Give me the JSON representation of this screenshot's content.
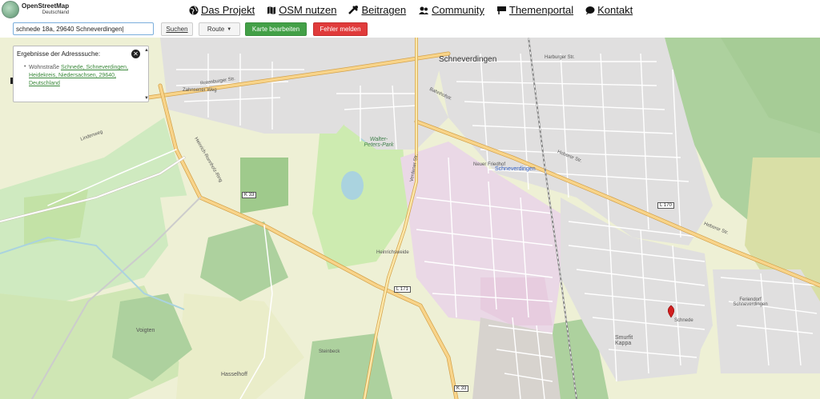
{
  "logo": {
    "title": "OpenStreetMap",
    "subtitle": "Deutschland"
  },
  "nav": [
    {
      "label": "Das Projekt",
      "icon": "globe-icon"
    },
    {
      "label": "OSM nutzen",
      "icon": "map-icon"
    },
    {
      "label": "Beitragen",
      "icon": "tools-icon"
    },
    {
      "label": "Community",
      "icon": "people-icon"
    },
    {
      "label": "Themenportal",
      "icon": "flag-icon"
    },
    {
      "label": "Kontakt",
      "icon": "chat-icon"
    }
  ],
  "toolbar": {
    "search_value": "schnede 18a, 29640 Schneverdingen|",
    "search_button": "Suchen",
    "route_button": "Route",
    "edit_button": "Karte bearbeiten",
    "report_button": "Fehler melden"
  },
  "results": {
    "title": "Ergebnisse der Adresssuche:",
    "item_prefix": "Wohnstraße",
    "item_link": "Schnede, Schneverdingen, Heidekreis, Niedersachsen, 29640, Deutschland"
  },
  "map": {
    "labels": {
      "town": "Schneverdingen",
      "station": "Schneverdingen",
      "park": "Walter-Peters-Park",
      "friedhof": "Neuer Friedhof",
      "smurfit": "Smurfit Kappa",
      "feriendorf": "Feriendorf Schneverdingen",
      "voigten": "Voigten",
      "hasselhoff": "Hasselhoff",
      "schnede": "Schnede",
      "rotenburger": "Rotenburger Str.",
      "bahnhof": "Bahnhofstr.",
      "heberer": "Heberer Str.",
      "heberer2": "Heberer Str.",
      "verdener": "Verdener Str.",
      "ring": "Heinrich-Ronnholz-Ring",
      "heinrich": "Heinrichsweide",
      "zahnsener": "Zahnsener Weg",
      "steinbeck": "Steinbeck",
      "harburger": "Harburger Str.",
      "lindenweg": "Lindenweg"
    },
    "shields": {
      "k33a": "K 33",
      "k33b": "K 33",
      "l171": "L 171",
      "l170": "L 170"
    }
  }
}
